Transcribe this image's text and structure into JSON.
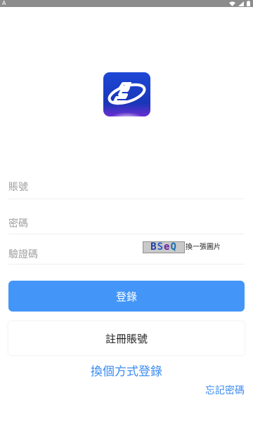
{
  "status_bar": {
    "left_icon": "A",
    "icons": [
      "wifi-icon",
      "signal-icon",
      "battery-icon"
    ]
  },
  "logo": {
    "icon": "app-logo-icon"
  },
  "form": {
    "account_placeholder": "賬號",
    "password_placeholder": "密碼",
    "captcha_placeholder": "驗證碼",
    "captcha_text": [
      "B",
      "S",
      "e",
      "Q"
    ],
    "captcha_refresh_label": "換一張圖片"
  },
  "buttons": {
    "login_label": "登錄",
    "register_label": "註冊賬號",
    "switch_login_label": "換個方式登錄",
    "forgot_password_label": "忘記密碼"
  },
  "colors": {
    "primary": "#4396f7",
    "link": "#3b8cf0",
    "status_bar": "#8c8c8c"
  }
}
